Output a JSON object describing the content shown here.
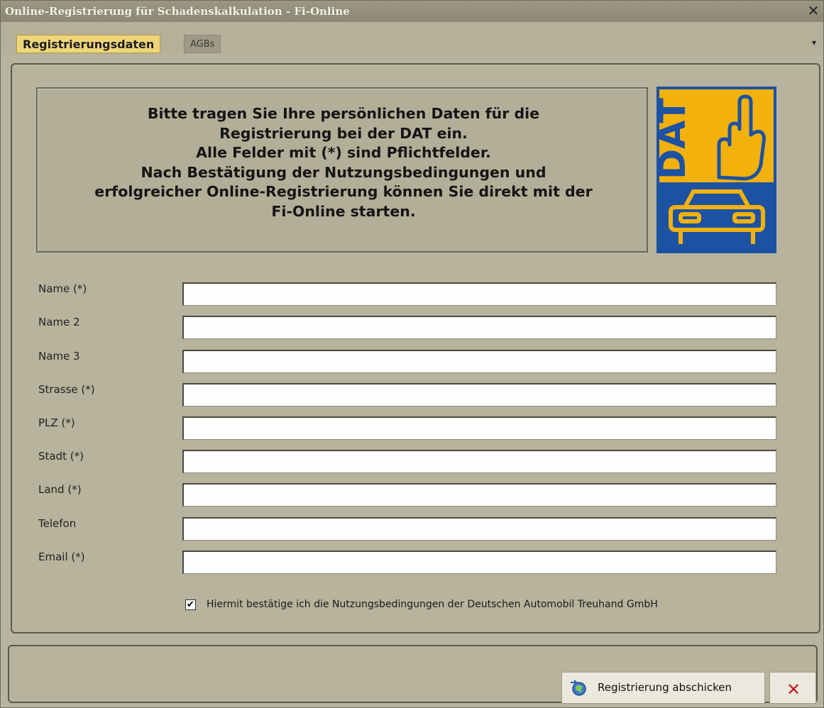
{
  "window": {
    "title": "Online-Registrierung für Schadenskalkulation - Fi-Online",
    "close_glyph": "✕"
  },
  "tabs": [
    {
      "label": "Registrierungsdaten",
      "active": true
    },
    {
      "label": "AGBs",
      "active": false
    }
  ],
  "tab_dropdown_glyph": "▾",
  "info": {
    "lines": [
      "Bitte tragen Sie Ihre persönlichen Daten für die",
      "Registrierung bei der DAT ein.",
      "Alle Felder mit (*) sind Pflichtfelder.",
      "Nach Bestätigung der Nutzungsbedingungen und",
      "erfolgreicher Online-Registrierung können Sie direkt mit der",
      "Fi-Online starten."
    ]
  },
  "logo": {
    "text": "DAT",
    "icon": "dat-logo",
    "colors": {
      "yellow": "#f2b10b",
      "blue": "#1d52a3"
    }
  },
  "fields": [
    {
      "label": "Name (*)",
      "value": ""
    },
    {
      "label": "Name 2",
      "value": ""
    },
    {
      "label": "Name 3",
      "value": ""
    },
    {
      "label": "Strasse (*)",
      "value": ""
    },
    {
      "label": "PLZ (*)",
      "value": ""
    },
    {
      "label": "Stadt (*)",
      "value": ""
    },
    {
      "label": "Land (*)",
      "value": ""
    },
    {
      "label": "Telefon",
      "value": ""
    },
    {
      "label": "Email (*)",
      "value": ""
    }
  ],
  "terms": {
    "checked": true,
    "check_glyph": "✔",
    "label": "Hiermit bestätige ich die Nutzungsbedingungen der Deutschen Automobil Treuhand GmbH"
  },
  "buttons": {
    "submit_label": "Registrierung abschicken",
    "submit_icon": "globe-arrow-icon",
    "cancel_icon": "cancel-x-icon",
    "cancel_glyph": "✕"
  }
}
